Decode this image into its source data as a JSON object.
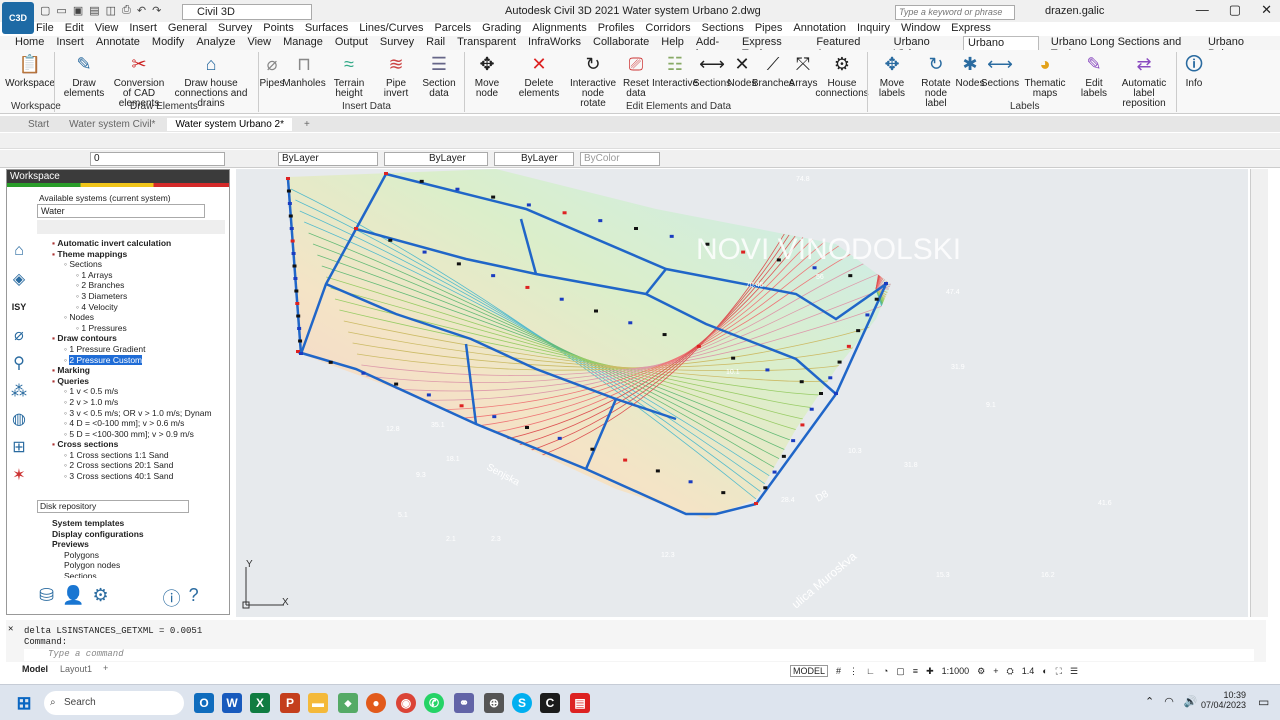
{
  "app": {
    "logo": "C3D",
    "workspace": "Civil 3D",
    "title": "Autodesk Civil 3D 2021   Water system Urbano 2.dwg",
    "search_placeholder": "Type a keyword or phrase",
    "user": "drazen.galic"
  },
  "menu": [
    "File",
    "Edit",
    "View",
    "Insert",
    "General",
    "Survey",
    "Points",
    "Surfaces",
    "Lines/Curves",
    "Parcels",
    "Grading",
    "Alignments",
    "Profiles",
    "Corridors",
    "Sections",
    "Pipes",
    "Annotation",
    "Inquiry",
    "Window",
    "Express"
  ],
  "ribbon_tabs": [
    "Home",
    "Insert",
    "Annotate",
    "Modify",
    "Analyze",
    "View",
    "Manage",
    "Output",
    "Survey",
    "Rail",
    "Transparent",
    "InfraWorks",
    "Collaborate",
    "Help",
    "Add-ins",
    "Express Tools",
    "Featured Apps",
    "Urbano Visio",
    "Urbano Layout",
    "Urbano Long Sections and Tools",
    "Urbano Polygon"
  ],
  "ribbon_active": "Urbano Layout",
  "ribbon": {
    "workspace": "Workspace",
    "draw_elements": "Draw elements",
    "conversion": "Conversion of CAD elements",
    "draw_house": "Draw house connections and drains",
    "pipes": "Pipes",
    "manholes": "Manholes",
    "terrain": "Terrain height",
    "pipe_invert": "Pipe invert",
    "section_data": "Section data",
    "move_node": "Move node",
    "delete_elements": "Delete elements",
    "interactive_rotate": "Interactive node rotate",
    "reset_data": "Reset data",
    "interactive": "Interactive",
    "sections": "Sections",
    "nodes": "Nodes",
    "branches": "Branches",
    "arrays": "Arrays",
    "house_connections": "House connections",
    "move_labels": "Move labels",
    "rotate_label": "Rotate node label",
    "nodes_lbl": "Nodes",
    "sections_lbl": "Sections",
    "thematic_maps": "Thematic maps",
    "edit_labels": "Edit labels",
    "auto_label": "Automatic label reposition",
    "info": "Info",
    "groups": {
      "workspace": "Workspace",
      "draw": "Draw Elements",
      "insert": "Insert Data",
      "edit": "Edit Elements and Data",
      "labels": "Labels"
    }
  },
  "doc_tabs": [
    "Start",
    "Water system Civil*",
    "Water system Urbano 2*"
  ],
  "layer": "0",
  "props": {
    "color": "ByLayer",
    "linetype": "ByLayer",
    "lineweight": "ByLayer",
    "plot": "ByColor"
  },
  "panel": {
    "title": "Workspace",
    "available_label": "Available systems (current system)",
    "system": "Water",
    "tree": [
      {
        "t": "Automatic invert calculation",
        "lvl": 1,
        "b": true
      },
      {
        "t": "Theme mappings",
        "lvl": 1,
        "b": true
      },
      {
        "t": "Sections",
        "lvl": 2
      },
      {
        "t": "1 Arrays",
        "lvl": 3
      },
      {
        "t": "2 Branches",
        "lvl": 3
      },
      {
        "t": "3 Diameters",
        "lvl": 3
      },
      {
        "t": "4 Velocity",
        "lvl": 3
      },
      {
        "t": "Nodes",
        "lvl": 2
      },
      {
        "t": "1 Pressures",
        "lvl": 3
      },
      {
        "t": "Draw contours",
        "lvl": 1,
        "b": true
      },
      {
        "t": "1 Pressure Gradient",
        "lvl": 2
      },
      {
        "t": "2 Pressure Custom",
        "lvl": 2,
        "sel": true
      },
      {
        "t": "Marking",
        "lvl": 1,
        "b": true
      },
      {
        "t": "Queries",
        "lvl": 1,
        "b": true
      },
      {
        "t": "1 v < 0.5 m/s",
        "lvl": 2
      },
      {
        "t": "2 v > 1.0 m/s",
        "lvl": 2
      },
      {
        "t": "3 v < 0.5 m/s; OR v > 1.0 m/s; Dynam",
        "lvl": 2
      },
      {
        "t": "4 D = <0-100 mm]; v > 0.6 m/s",
        "lvl": 2
      },
      {
        "t": "5 D = <100-300 mm]; v > 0.9 m/s",
        "lvl": 2
      },
      {
        "t": "Cross sections",
        "lvl": 1,
        "b": true
      },
      {
        "t": "1 Cross sections 1:1 Sand",
        "lvl": 2
      },
      {
        "t": "2 Cross sections 20:1 Sand",
        "lvl": 2
      },
      {
        "t": "3 Cross sections 40:1 Sand",
        "lvl": 2
      }
    ],
    "repo_label": "Disk repository",
    "repo_tree": [
      {
        "t": "System templates",
        "b": true
      },
      {
        "t": "Display configurations",
        "b": true
      },
      {
        "t": "Previews",
        "b": true
      },
      {
        "t": "Polygons",
        "b": false
      },
      {
        "t": "Polygon nodes",
        "b": false
      },
      {
        "t": "Sections",
        "b": false
      }
    ]
  },
  "map": {
    "town": "NOVI VINODOLSKI",
    "street1": "Senjska",
    "street2": "ulica Muroskva",
    "road": "D8",
    "labels": [
      "74.8",
      "70.45",
      "47.4",
      "56",
      "31.9",
      "9.1",
      "12.8",
      "18.1",
      "9.3",
      "5.1",
      "2.1",
      "2.3",
      "12.3",
      "15.3",
      "16.2",
      "28.4",
      "10.3",
      "31.8",
      "41.6",
      "35.1",
      "10.1"
    ],
    "axis_y": "Y",
    "axis_x": "X"
  },
  "command": {
    "history": "delta LSINSTANCES_GETXML = 0.0051",
    "prompt": "Command:",
    "placeholder": "Type a command"
  },
  "layout_tabs": [
    "Model",
    "Layout1"
  ],
  "status": {
    "model": "MODEL",
    "scale": "1:1000",
    "anno": "1.4"
  },
  "taskbar": {
    "search": "Search",
    "time": "10:39",
    "date": "07/04/2023"
  }
}
